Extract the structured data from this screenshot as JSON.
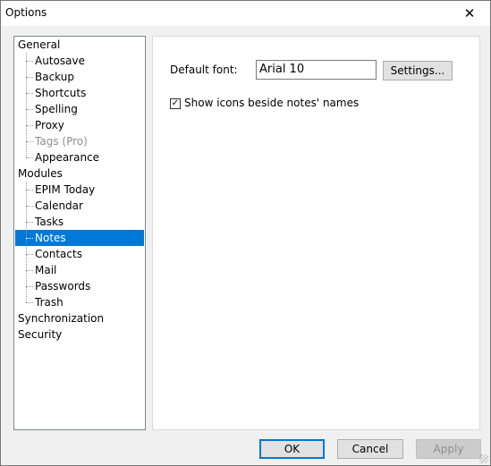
{
  "window": {
    "title": "Options",
    "close_glyph": "✕"
  },
  "tree": [
    {
      "label": "General",
      "level": 0
    },
    {
      "label": "Autosave",
      "level": 1
    },
    {
      "label": "Backup",
      "level": 1
    },
    {
      "label": "Shortcuts",
      "level": 1
    },
    {
      "label": "Spelling",
      "level": 1
    },
    {
      "label": "Proxy",
      "level": 1
    },
    {
      "label": "Tags (Pro)",
      "level": 1,
      "disabled": true
    },
    {
      "label": "Appearance",
      "level": 1
    },
    {
      "label": "Modules",
      "level": 0
    },
    {
      "label": "EPIM Today",
      "level": 1
    },
    {
      "label": "Calendar",
      "level": 1
    },
    {
      "label": "Tasks",
      "level": 1
    },
    {
      "label": "Notes",
      "level": 1,
      "selected": true
    },
    {
      "label": "Contacts",
      "level": 1
    },
    {
      "label": "Mail",
      "level": 1
    },
    {
      "label": "Passwords",
      "level": 1
    },
    {
      "label": "Trash",
      "level": 1
    },
    {
      "label": "Synchronization",
      "level": 0
    },
    {
      "label": "Security",
      "level": 0
    }
  ],
  "panel": {
    "font_label": "Default font:",
    "font_value": "Arial 10",
    "settings_button": "Settings...",
    "show_icons_label": "Show icons beside notes' names",
    "show_icons_checked": true,
    "check_glyph": "✓"
  },
  "footer": {
    "ok": "OK",
    "cancel": "Cancel",
    "apply": "Apply",
    "apply_enabled": false
  },
  "colors": {
    "selection": "#0078d7",
    "disabled_text": "#8d8d8d"
  }
}
